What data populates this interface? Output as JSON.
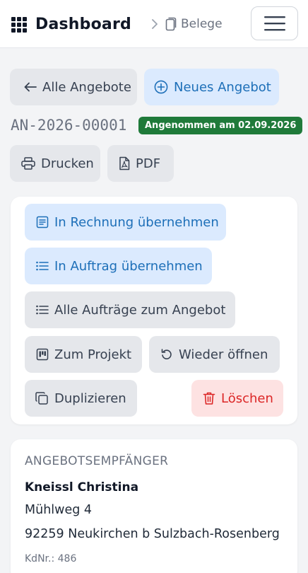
{
  "header": {
    "title": "Dashboard",
    "breadcrumb": "Belege",
    "icons": {
      "brand": "grid-icon",
      "breadcrumb": "document-icon",
      "menu": "hamburger-icon"
    }
  },
  "nav": {
    "back_label": "Alle Angebote",
    "new_label": "Neues Angebot"
  },
  "document": {
    "number": "AN-2026-00001",
    "status": "Angenommen am 02.09.2026",
    "status_color": "#1f7a3a"
  },
  "toolbar": {
    "print_label": "Drucken",
    "pdf_label": "PDF"
  },
  "actions": {
    "invoice_label": "In Rechnung übernehmen",
    "order_label": "In Auftrag übernehmen",
    "all_orders_label": "Alle Aufträge zum Angebot",
    "project_label": "Zum Projekt",
    "reopen_label": "Wieder öffnen",
    "duplicate_label": "Duplizieren",
    "delete_label": "Löschen"
  },
  "recipient": {
    "section_title": "ANGEBOTSEMPFÄNGER",
    "name": "Kneissl Christina",
    "street": "Mühlweg 4",
    "city": "92259 Neukirchen b Sulzbach-Rosenberg",
    "customer_no": "KdNr.: 486"
  },
  "colors": {
    "accent_blue": "#1d6fb8",
    "danger_red": "#dc2626",
    "success_green": "#1f7a3a"
  }
}
